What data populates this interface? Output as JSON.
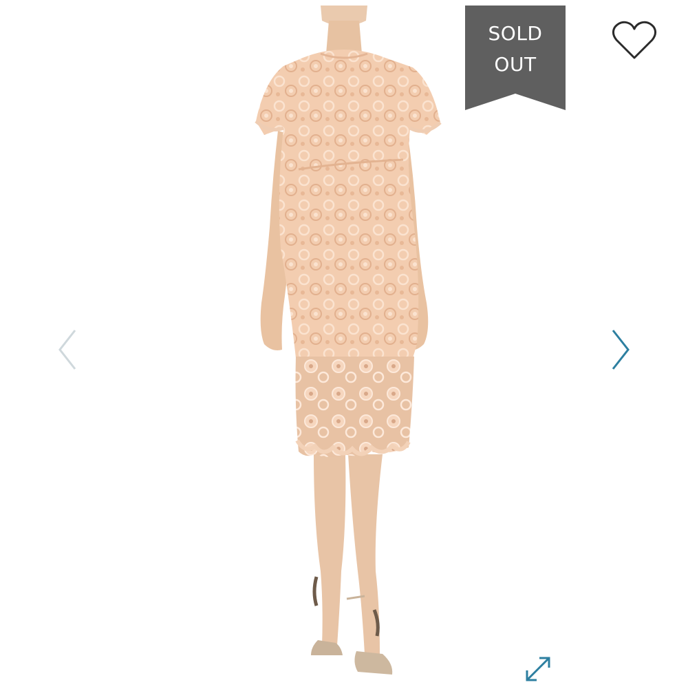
{
  "badge": {
    "line1": "SOLD",
    "line2": "OUT",
    "color": "#5f5f5f"
  },
  "icons": {
    "like": "heart-outline-icon",
    "prev": "chevron-left-icon",
    "next": "chevron-right-icon",
    "expand": "expand-arrows-icon"
  },
  "colors": {
    "nav_active": "#2d7fa0",
    "nav_inactive": "#cfd8dc",
    "icon_dark": "#2b2b2b",
    "dress": "#f1c8aa",
    "skin": "#e9c3a3"
  }
}
